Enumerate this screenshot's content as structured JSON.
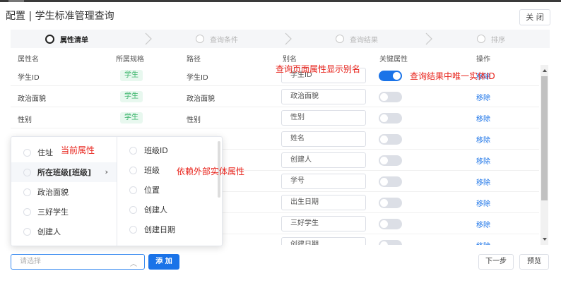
{
  "window": {
    "title": "配置 | 学生标准管理查询",
    "close_label": "关 闭"
  },
  "steps": [
    {
      "label": "属性清单",
      "active": true
    },
    {
      "label": "查询条件",
      "active": false
    },
    {
      "label": "查询结果",
      "active": false
    },
    {
      "label": "排序",
      "active": false
    }
  ],
  "columns": [
    "属性名",
    "所属规格",
    "路径",
    "别名",
    "关键属性",
    "操作"
  ],
  "rows": [
    {
      "name": "学生ID",
      "spec": "学生",
      "path": "学生ID",
      "alias": "学生ID",
      "key": true,
      "action": "移除"
    },
    {
      "name": "政治面貌",
      "spec": "学生",
      "path": "政治面貌",
      "alias": "政治面貌",
      "key": false,
      "action": "移除"
    },
    {
      "name": "性别",
      "spec": "学生",
      "path": "性别",
      "alias": "性别",
      "key": false,
      "action": "移除"
    },
    {
      "alias": "姓名",
      "key": false,
      "action": "移除"
    },
    {
      "alias": "创建人",
      "key": false,
      "action": "移除"
    },
    {
      "alias": "学号",
      "key": false,
      "action": "移除"
    },
    {
      "alias": "出生日期",
      "key": false,
      "action": "移除"
    },
    {
      "alias": "三好学生",
      "key": false,
      "action": "移除"
    },
    {
      "alias": "创建日期",
      "key": false,
      "action": "移除"
    }
  ],
  "annotations": {
    "alias_note": "查询页面属性显示别名",
    "key_note": "查询结果中唯一实体ID",
    "current_attr_note": "当前属性",
    "external_note": "依赖外部实体属性"
  },
  "cascader": {
    "level1": [
      "住址",
      "所在班级[班级]",
      "政治面貌",
      "三好学生",
      "创建人"
    ],
    "level1_selected": "所在班级[班级]",
    "level2": [
      "班级ID",
      "班级",
      "位置",
      "创建人",
      "创建日期"
    ]
  },
  "footer": {
    "select_placeholder": "请选择",
    "add_label": "添 加",
    "next_label": "下一步",
    "preview_label": "预览"
  },
  "colors": {
    "accent": "#1a73e8",
    "tag_green": "#3bb56b",
    "annotation_red": "#e8231b"
  }
}
